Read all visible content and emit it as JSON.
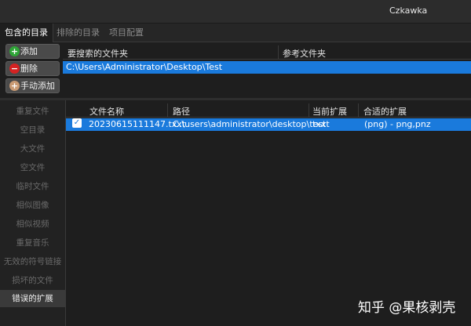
{
  "app": {
    "title": "Czkawka"
  },
  "tabs": [
    {
      "label": "包含的目录",
      "active": true
    },
    {
      "label": "排除的目录",
      "active": false
    },
    {
      "label": "项目配置",
      "active": false
    }
  ],
  "dir_buttons": {
    "add": "添加",
    "remove": "删除",
    "manual_add": "手动添加"
  },
  "dir_table": {
    "columns": [
      "要搜索的文件夹",
      "参考文件夹"
    ],
    "rows": [
      {
        "path": "C:\\Users\\Administrator\\Desktop\\Test"
      }
    ]
  },
  "sidebar": {
    "items": [
      {
        "label": "重复文件",
        "active": false
      },
      {
        "label": "空目录",
        "active": false
      },
      {
        "label": "大文件",
        "active": false
      },
      {
        "label": "空文件",
        "active": false
      },
      {
        "label": "临时文件",
        "active": false
      },
      {
        "label": "相似图像",
        "active": false
      },
      {
        "label": "相似视频",
        "active": false
      },
      {
        "label": "重复音乐",
        "active": false
      },
      {
        "label": "无效的符号链接",
        "active": false
      },
      {
        "label": "损坏的文件",
        "active": false
      },
      {
        "label": "错误的扩展",
        "active": true
      }
    ]
  },
  "results": {
    "columns": [
      "文件名称",
      "路径",
      "当前扩展",
      "合适的扩展"
    ],
    "rows": [
      {
        "checked": true,
        "name": "20230615111147.txxt",
        "path": "C:\\users\\administrator\\desktop\\test",
        "current_ext": "txxt",
        "proper_ext": "(png) - png,pnz"
      }
    ]
  },
  "watermark": "知乎 @果核剥壳",
  "colors": {
    "selection": "#1a7adc",
    "background": "#1e1e1e",
    "add_icon": "#2fa537",
    "remove_icon": "#d52222"
  }
}
